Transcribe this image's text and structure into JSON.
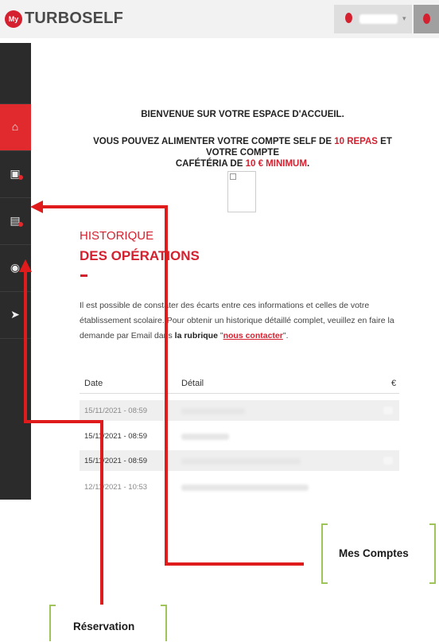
{
  "app": {
    "logo_badge": "My",
    "logo_text": "TURBOSELF"
  },
  "header": {
    "user_caret": "▾"
  },
  "sidebar": {
    "items": [
      {
        "icon": "home-icon",
        "glyph": "⌂"
      },
      {
        "icon": "wallet-icon",
        "glyph": "▣"
      },
      {
        "icon": "calendar-icon",
        "glyph": "▤"
      },
      {
        "icon": "globe-icon",
        "glyph": "◉"
      },
      {
        "icon": "send-icon",
        "glyph": "➤"
      }
    ]
  },
  "welcome": {
    "line1": "BIENVENUE SUR VOTRE ESPACE D'ACCUEIL.",
    "line2_a": "VOUS POUVEZ ALIMENTER VOTRE COMPTE SELF DE ",
    "line2_red": "10 REPAS",
    "line2_b": " ET VOTRE COMPTE",
    "line3_a": "CAFÉTÉRIA DE ",
    "line3_red": "10 € MINIMUM",
    "line3_b": "."
  },
  "history": {
    "title_light": "HISTORIQUE",
    "title_bold": "DES OPÉRATIONS",
    "info_a": "Il est possible de constater des écarts entre ces informations et celles de votre établissement scolaire. Pour obtenir un historique détaillé complet, veuillez en faire la demande par Email dans ",
    "info_bold": "la rubrique",
    "info_q": " \"",
    "info_link": "nous contacter",
    "info_end": "\".",
    "columns": [
      "Date",
      "Détail",
      "€"
    ],
    "rows": [
      {
        "date": "15/11/2021 - 08:59"
      },
      {
        "date": "15/11/2021 - 08:59"
      },
      {
        "date": "15/11/2021 - 08:59"
      },
      {
        "date": "12/11/2021 - 10:53"
      }
    ]
  },
  "annotations": {
    "mes_comptes": "Mes Comptes",
    "reservation": "Réservation"
  },
  "colors": {
    "brand_red": "#d5202f",
    "arrow_red": "#e01b1b",
    "callout_green": "#9fc45a",
    "sidebar_dark": "#2b2b2b"
  }
}
